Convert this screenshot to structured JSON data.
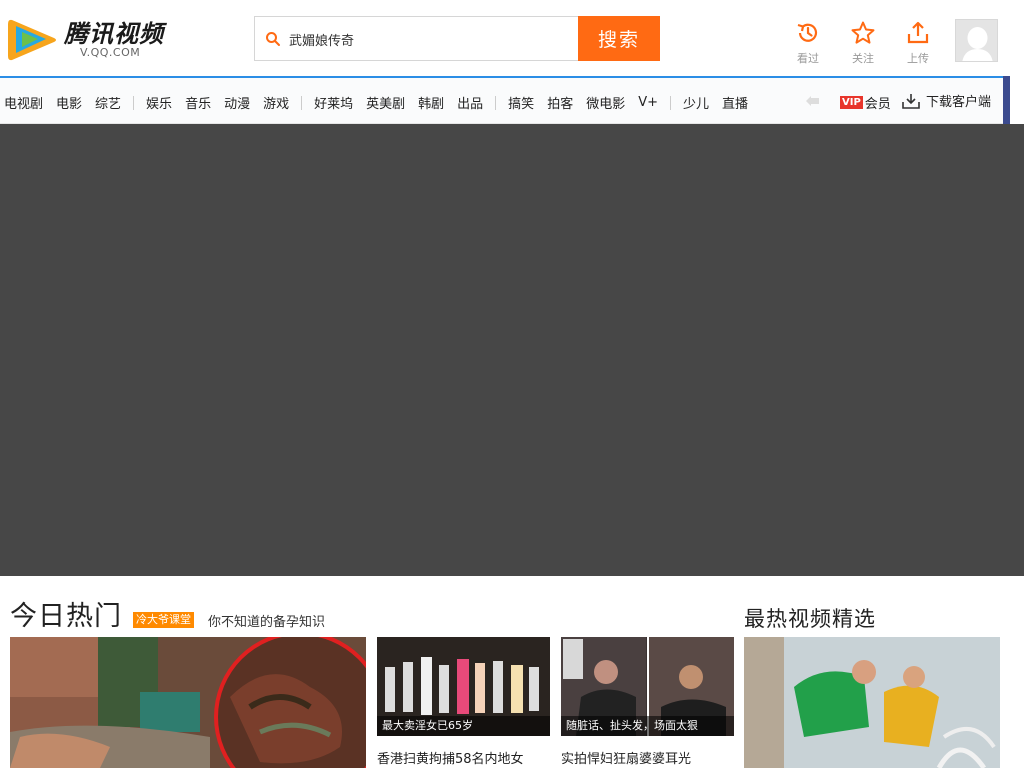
{
  "header": {
    "logo_text": "腾讯视频",
    "logo_sub": "V.QQ.COM",
    "search_value": "武媚娘传奇",
    "search_button": "搜索",
    "tools": [
      {
        "label": "看过",
        "icon": "history-icon"
      },
      {
        "label": "关注",
        "icon": "star-icon"
      },
      {
        "label": "上传",
        "icon": "upload-icon"
      }
    ]
  },
  "nav": {
    "group1": [
      "电视剧",
      "电影",
      "综艺"
    ],
    "group2": [
      "娱乐",
      "音乐",
      "动漫",
      "游戏"
    ],
    "group3": [
      "好莱坞",
      "英美剧",
      "韩剧",
      "出品"
    ],
    "group4": [
      "搞笑",
      "拍客",
      "微电影",
      "V+"
    ],
    "group5": [
      "少儿",
      "直播"
    ],
    "vip_badge": "VIP",
    "vip_label": "会员",
    "download_label": "下载客户端"
  },
  "hot": {
    "title": "今日热门",
    "tag": "冷大爷课堂",
    "subtitle": "你不知道的备孕知识",
    "items": [
      {
        "caption": "最大卖淫女已65岁",
        "title": "香港扫黄拘捕58名内地女"
      },
      {
        "caption": "随脏话、扯头发，场面太狠",
        "title": "实拍悍妇狂扇婆婆耳光"
      }
    ]
  },
  "picks": {
    "title": "最热视频精选"
  },
  "colors": {
    "accent": "#ff6a13",
    "nav_border": "#2b8ee6",
    "banner": "#474747",
    "vip": "#e8352b"
  }
}
